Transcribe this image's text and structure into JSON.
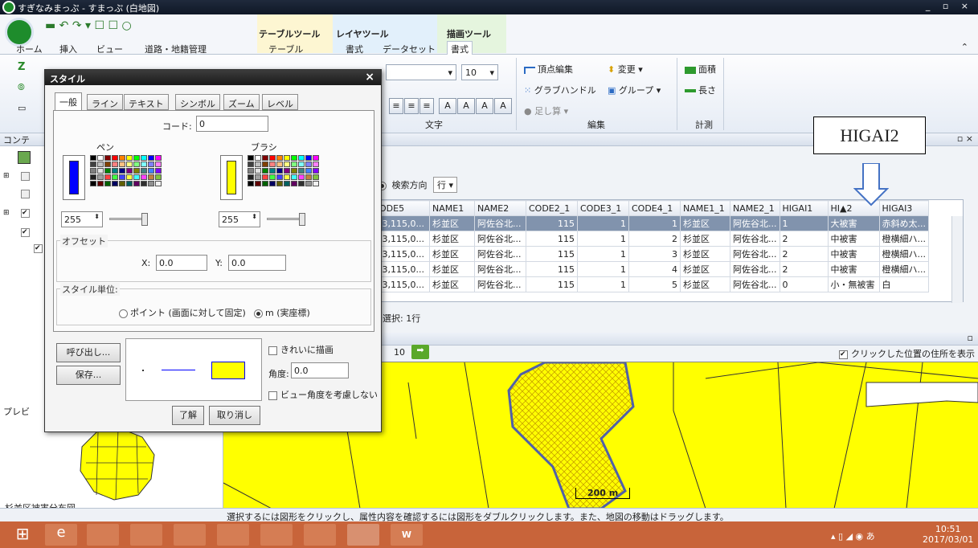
{
  "app": {
    "title": "すぎなみまっぷ - すまっぷ (白地図)"
  },
  "window_controls": "_ ▫ ×",
  "ribbon_tabs": [
    "ホーム",
    "挿入",
    "ビュー",
    "道路・地籍管理",
    "テーブル",
    "書式",
    "データセット",
    "書式"
  ],
  "context_groups": [
    "テーブルツール",
    "レイヤツール",
    "描画ツール"
  ],
  "ribbon": {
    "font_size": "10",
    "format_buttons": [
      "≡",
      "≡",
      "≡",
      "A",
      "A",
      "A",
      "A"
    ],
    "group_text": "文字",
    "edit": {
      "vertex": "頂点編集",
      "change": "変更",
      "grip": "グラブハンドル",
      "group": "グループ",
      "sum": "足し算",
      "label": "編集"
    },
    "measure": {
      "area": "面積",
      "length": "長さ",
      "label": "計測"
    }
  },
  "left_panel": {
    "contents_label": "コンテ",
    "preview_label": "プレビ",
    "map_name": "杉並区被害分布図"
  },
  "search": {
    "direction_label": "検索方向",
    "direction_value": "行"
  },
  "grid": {
    "columns": [
      "ODE5",
      "NAME1",
      "NAME2",
      "CODE2_1",
      "CODE3_1",
      "CODE4_1",
      "NAME1_1",
      "NAME2_1",
      "HIGAI1",
      "HI▲2",
      "HIGAI3"
    ],
    "rows": [
      [
        ",3,115,0...",
        "杉並区",
        "阿佐谷北...",
        "115",
        "1",
        "1",
        "杉並区",
        "阿佐谷北...",
        "1",
        "大被害",
        "赤斜め太..."
      ],
      [
        ",3,115,0...",
        "杉並区",
        "阿佐谷北...",
        "115",
        "1",
        "2",
        "杉並区",
        "阿佐谷北...",
        "2",
        "中被害",
        "橙横細ハ..."
      ],
      [
        ",3,115,0...",
        "杉並区",
        "阿佐谷北...",
        "115",
        "1",
        "3",
        "杉並区",
        "阿佐谷北...",
        "2",
        "中被害",
        "橙横細ハ..."
      ],
      [
        ",3,115,0...",
        "杉並区",
        "阿佐谷北...",
        "115",
        "1",
        "4",
        "杉並区",
        "阿佐谷北...",
        "2",
        "中被害",
        "橙横細ハ..."
      ],
      [
        ",3,115,0...",
        "杉並区",
        "阿佐谷北...",
        "115",
        "1",
        "5",
        "杉並区",
        "阿佐谷北...",
        "0",
        "小・無被害",
        "白"
      ]
    ],
    "selection": "選択: 1行"
  },
  "annotation": {
    "label": "HIGAI2"
  },
  "map": {
    "zoom_value": "10",
    "show_address_label": "クリックした位置の住所を表示",
    "scale": "200 m"
  },
  "status": "選択するには図形をクリックし、属性内容を確認するには図形をダブルクリックします。また、地図の移動はドラッグします。",
  "clock": {
    "time": "10:51",
    "date": "2017/03/01"
  },
  "dialog": {
    "title": "スタイル",
    "tabs": [
      "一般",
      "ライン",
      "テキスト",
      "シンボル",
      "ズーム",
      "レベル"
    ],
    "code_label": "コード:",
    "code_value": "0",
    "pen_label": "ペン",
    "brush_label": "ブラシ",
    "pen_color": "#0000ff",
    "brush_color": "#ffff00",
    "pen_alpha": "255",
    "brush_alpha": "255",
    "offset_label": "オフセット",
    "x_label": "X:",
    "x_value": "0.0",
    "y_label": "Y:",
    "y_value": "0.0",
    "unit_label": "スタイル単位:",
    "unit_point": "ポイント (画面に対して固定)",
    "unit_m": "m (実座標)",
    "call_button": "呼び出し...",
    "save_button": "保存...",
    "pretty_label": "きれいに描画",
    "angle_label": "角度:",
    "angle_value": "0.0",
    "ignore_view_label": "ビュー角度を考慮しない",
    "ok_button": "了解",
    "cancel_button": "取り消し"
  }
}
